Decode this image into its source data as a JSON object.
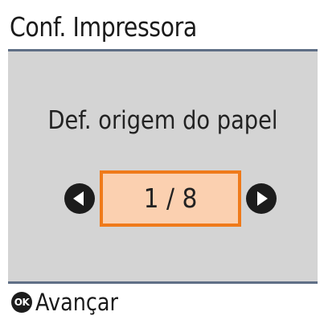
{
  "header": {
    "title": "Conf. Impressora"
  },
  "main": {
    "prompt": "Def. origem do papel",
    "pager": {
      "display": "1 / 8"
    }
  },
  "footer": {
    "ok_icon_label": "OK",
    "ok_label": "Avançar"
  },
  "icons": {
    "prev": "arrow-left-icon",
    "next": "arrow-right-icon",
    "ok": "ok-button-icon"
  },
  "colors": {
    "header_rule": "#5f6f86",
    "panel_bg": "#d4d4d4",
    "highlight_fill": "#fbd0b0",
    "highlight_border": "#ef7a1a",
    "icon": "#1c1c1c"
  }
}
